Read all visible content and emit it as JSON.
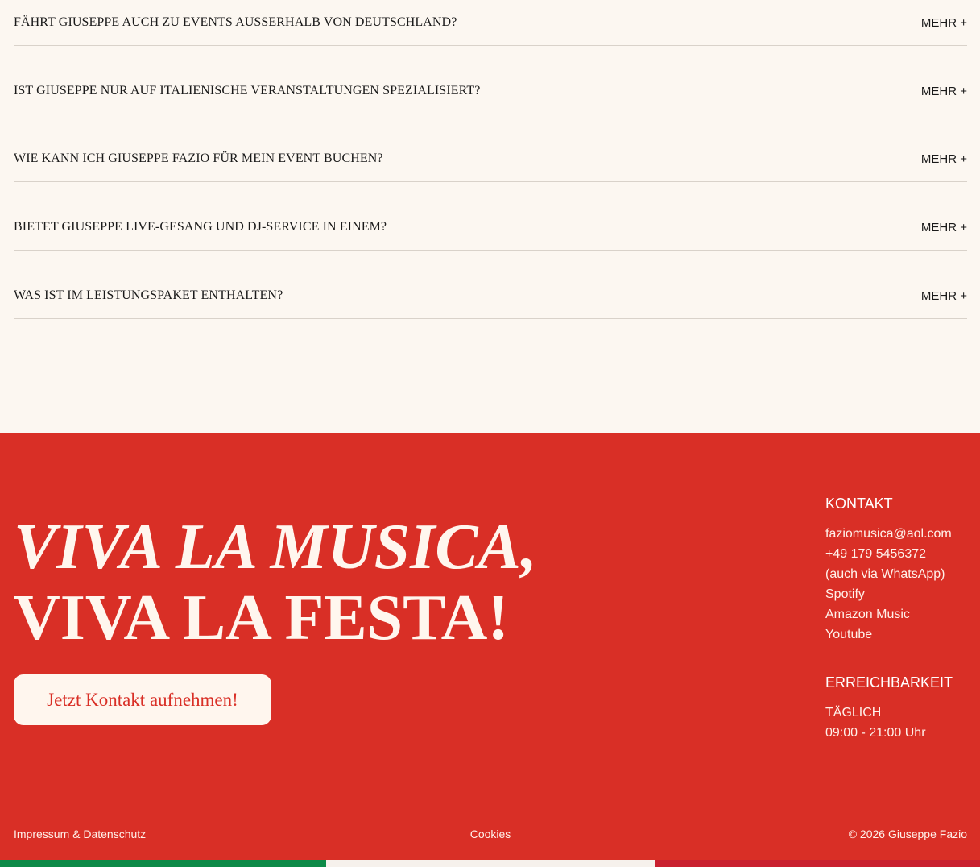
{
  "faq": {
    "items": [
      {
        "question": "Fährt Giuseppe auch zu Events außerhalb von Deutschland?",
        "more": "MEHR +"
      },
      {
        "question": "Ist Giuseppe nur auf italienische Veranstaltungen spezialisiert?",
        "more": "MEHR +"
      },
      {
        "question": "Wie kann ich Giuseppe Fazio für mein Event buchen?",
        "more": "MEHR +"
      },
      {
        "question": "Bietet Giuseppe Live-Gesang und DJ-Service in einem?",
        "more": "MEHR +"
      },
      {
        "question": "Was ist im Leistungspaket enthalten?",
        "more": "MEHR +"
      }
    ]
  },
  "footer": {
    "headline_line1": "VIVA LA MUSICA,",
    "headline_line2": "VIVA LA FESTA!",
    "cta_label": "Jetzt Kontakt aufnehmen!",
    "contact": {
      "title": "KONTAKT",
      "email": "faziomusica@aol.com",
      "phone": "+49 179 5456372",
      "phone_note": "(auch via WhatsApp)",
      "links": [
        "Spotify",
        "Amazon Music",
        "Youtube"
      ]
    },
    "availability": {
      "title": "ERREICHBARKEIT",
      "days": "TÄGLICH",
      "time": "09:00 - 21:00 Uhr"
    },
    "bottom": {
      "legal": "Impressum & Datenschutz",
      "cookies": "Cookies",
      "copyright": "© 2026 Giuseppe Fazio"
    }
  },
  "colors": {
    "background": "#fcf7f1",
    "footer_red": "#d92f26",
    "flag_green": "#0c8a48",
    "flag_white": "#f6f1ec",
    "flag_red": "#c9202f"
  }
}
